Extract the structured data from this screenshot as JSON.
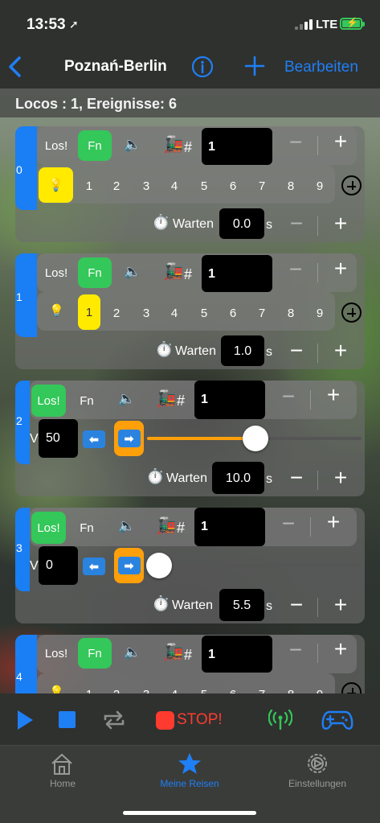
{
  "status": {
    "time": "13:53",
    "carrier": "LTE"
  },
  "nav": {
    "title": "Poznań-Berlin",
    "edit_label": "Bearbeiten"
  },
  "summary": "Locos : 1, Ereignisse: 6",
  "common": {
    "go_label": "Los!",
    "fn_label": "Fn",
    "hash_label": "#",
    "wait_label": "Warten",
    "unit_label": "s",
    "v_label": "V",
    "numbers": [
      "1",
      "2",
      "3",
      "4",
      "5",
      "6",
      "7",
      "8",
      "9"
    ]
  },
  "cards": [
    {
      "index": "0",
      "address": "1",
      "wait": "0.0"
    },
    {
      "index": "1",
      "address": "1",
      "wait": "1.0"
    },
    {
      "index": "2",
      "address": "1",
      "speed": "50",
      "wait": "10.0"
    },
    {
      "index": "3",
      "address": "1",
      "speed": "0",
      "wait": "5.5"
    },
    {
      "index": "4",
      "address": "1"
    }
  ],
  "player": {
    "stop_label": "STOP!"
  },
  "tabs": [
    {
      "label": "Home",
      "icon": "home-icon"
    },
    {
      "label": "Meine Reisen",
      "icon": "star-icon"
    },
    {
      "label": "Einstellungen",
      "icon": "settings-icon"
    }
  ],
  "colors": {
    "accent": "#1f7ff5",
    "green": "#34c759",
    "yellow": "#ffea00",
    "orange": "#ff9f0a",
    "stop": "#ff3b30"
  }
}
